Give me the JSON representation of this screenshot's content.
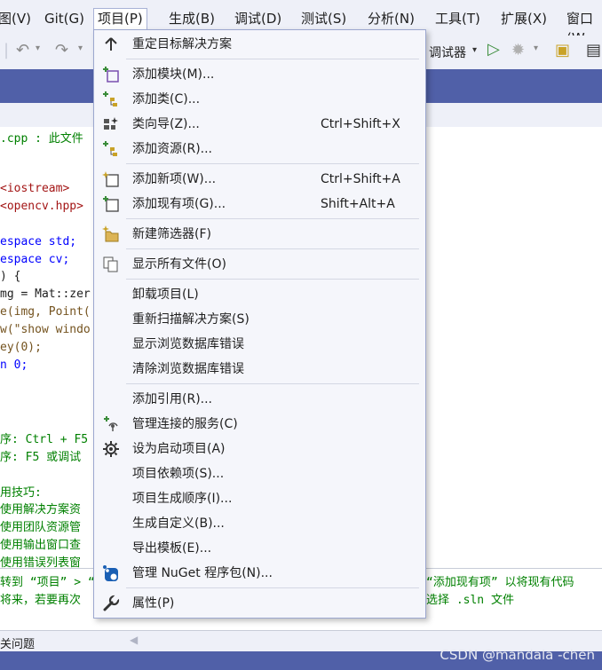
{
  "menubar": {
    "items": [
      {
        "label": "图(V)"
      },
      {
        "label": "Git(G)"
      },
      {
        "label": "项目(P)"
      },
      {
        "label": "生成(B)"
      },
      {
        "label": "调试(D)"
      },
      {
        "label": "测试(S)"
      },
      {
        "label": "分析(N)"
      },
      {
        "label": "工具(T)"
      },
      {
        "label": "扩展(X)"
      },
      {
        "label": "窗口(W"
      }
    ],
    "active_index": 2
  },
  "toolbar": {
    "debugger_label": "调试器"
  },
  "code_lines": [
    {
      "text": ".cpp : 此文件",
      "kind": "comment"
    },
    {
      "text": "<iostream>",
      "kind": "include"
    },
    {
      "text": "<opencv.hpp>",
      "kind": "include"
    },
    {
      "text": "espace std;",
      "kind": "kw"
    },
    {
      "text": "espace cv;",
      "kind": "kw"
    },
    {
      "text": ") {",
      "kind": "plain"
    },
    {
      "text": "mg = Mat::zer",
      "kind": "plain"
    },
    {
      "text": "e(img, Point(",
      "kind": "fn"
    },
    {
      "text": "w(\"show windo",
      "kind": "fn"
    },
    {
      "text": "ey(0);",
      "kind": "fn"
    },
    {
      "text": "n 0;",
      "kind": "kw"
    },
    {
      "text": "序: Ctrl + F5",
      "kind": "comment"
    },
    {
      "text": "序: F5 或调试",
      "kind": "comment"
    },
    {
      "text": "用技巧:",
      "kind": "comment"
    },
    {
      "text": "使用解决方案资",
      "kind": "comment"
    },
    {
      "text": "使用团队资源管",
      "kind": "comment"
    },
    {
      "text": "使用输出窗口查",
      "kind": "comment"
    },
    {
      "text": "使用错误列表窗",
      "kind": "comment"
    },
    {
      "text": "转到 “项目” > “",
      "kind": "comment"
    },
    {
      "text": "将来，若要再次",
      "kind": "comment"
    }
  ],
  "code_right": [
    {
      "text": "“添加现有项” 以将现有代码"
    },
    {
      "text": "选择 .sln 文件"
    }
  ],
  "bottom_tab_label": "关问题",
  "watermark": "CSDN @mandala -chen",
  "menu": {
    "items": [
      {
        "label": "重定目标解决方案",
        "shortcut": "",
        "icon": "up-arrow-icon"
      },
      {
        "label": "添加模块(M)...",
        "shortcut": "",
        "icon": "add-module-icon"
      },
      {
        "label": "添加类(C)...",
        "shortcut": "",
        "icon": "add-class-icon"
      },
      {
        "label": "类向导(Z)...",
        "shortcut": "Ctrl+Shift+X",
        "icon": "class-wizard-icon"
      },
      {
        "label": "添加资源(R)...",
        "shortcut": "",
        "icon": "add-resource-icon"
      },
      {
        "label": "添加新项(W)...",
        "shortcut": "Ctrl+Shift+A",
        "icon": "add-new-item-icon"
      },
      {
        "label": "添加现有项(G)...",
        "shortcut": "Shift+Alt+A",
        "icon": "add-existing-item-icon"
      },
      {
        "label": "新建筛选器(F)",
        "shortcut": "",
        "icon": "new-filter-icon"
      },
      {
        "label": "显示所有文件(O)",
        "shortcut": "",
        "icon": "show-all-files-icon"
      },
      {
        "label": "卸载项目(L)",
        "shortcut": "",
        "icon": ""
      },
      {
        "label": "重新扫描解决方案(S)",
        "shortcut": "",
        "icon": ""
      },
      {
        "label": "显示浏览数据库错误",
        "shortcut": "",
        "icon": ""
      },
      {
        "label": "清除浏览数据库错误",
        "shortcut": "",
        "icon": ""
      },
      {
        "label": "添加引用(R)...",
        "shortcut": "",
        "icon": ""
      },
      {
        "label": "管理连接的服务(C)",
        "shortcut": "",
        "icon": "connected-services-icon"
      },
      {
        "label": "设为启动项目(A)",
        "shortcut": "",
        "icon": "gear-icon"
      },
      {
        "label": "项目依赖项(S)...",
        "shortcut": "",
        "icon": ""
      },
      {
        "label": "项目生成顺序(I)...",
        "shortcut": "",
        "icon": ""
      },
      {
        "label": "生成自定义(B)...",
        "shortcut": "",
        "icon": ""
      },
      {
        "label": "导出模板(E)...",
        "shortcut": "",
        "icon": ""
      },
      {
        "label": "管理 NuGet 程序包(N)...",
        "shortcut": "",
        "icon": "nuget-icon"
      },
      {
        "label": "属性(P)",
        "shortcut": "",
        "icon": "wrench-icon"
      }
    ]
  },
  "colors": {
    "accent": "#5060a8",
    "menu_bg": "#f5f6fb",
    "menu_border": "#9ca7cf",
    "icon_green": "#3a8c3a",
    "icon_gold": "#c9a227",
    "icon_blue": "#1a5fb4"
  }
}
